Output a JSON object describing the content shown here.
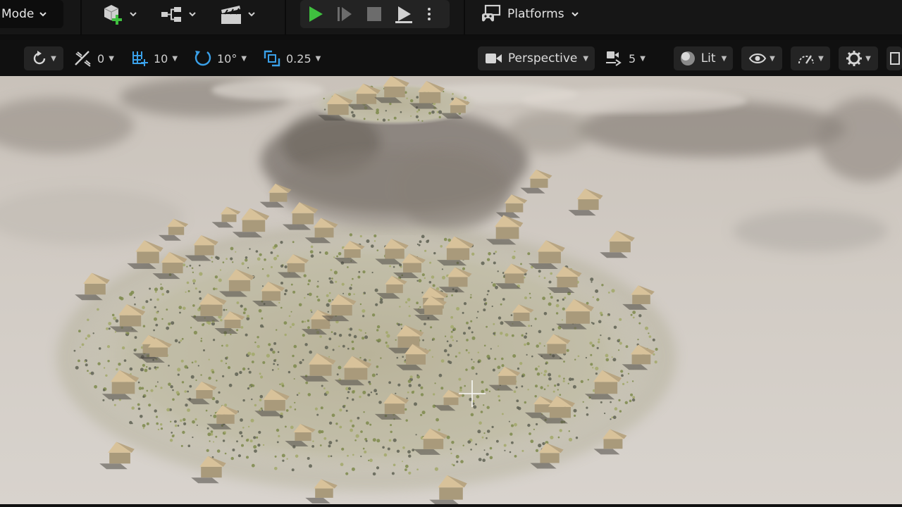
{
  "main_toolbar": {
    "mode_label": "Mode",
    "platforms_label": "Platforms",
    "icons": [
      "add-actor-icon",
      "blueprint-icon",
      "cinematics-icon",
      "play-icon",
      "advance-frame-icon",
      "stop-icon",
      "eject-icon",
      "more-options-icon",
      "platforms-icon"
    ],
    "colors": {
      "play": "#3fbf3f",
      "add_plus": "#3fbf3f"
    }
  },
  "viewport_toolbar": {
    "translate_snap_value": "0",
    "grid_snap_value": "10",
    "rotation_snap_value": "10°",
    "scale_snap_value": "0.25",
    "view_mode_label": "Perspective",
    "camera_speed_value": "5",
    "lighting_mode_label": "Lit",
    "colors": {
      "snap_icons": "#3aa0e8"
    }
  }
}
